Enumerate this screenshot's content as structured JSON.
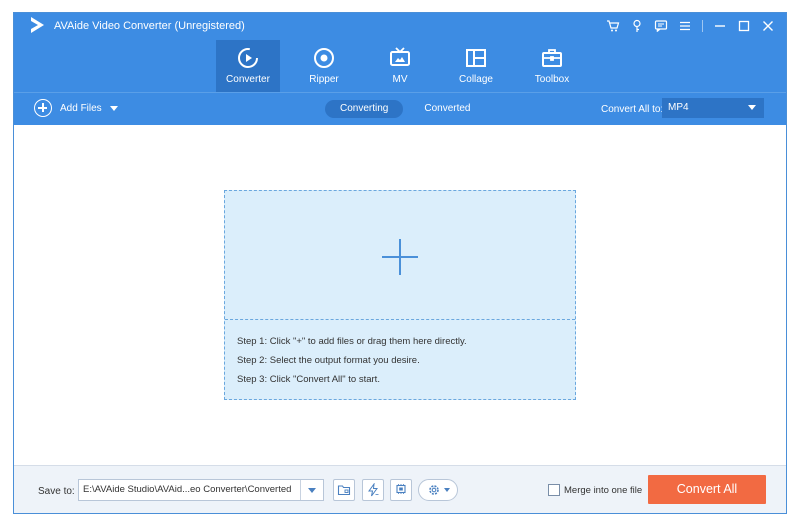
{
  "app": {
    "title": "AVAide Video Converter (Unregistered)"
  },
  "window_controls": [
    {
      "name": "cart-icon"
    },
    {
      "name": "key-icon"
    },
    {
      "name": "feedback-icon"
    },
    {
      "name": "menu-icon"
    },
    {
      "name": "minimize-icon"
    },
    {
      "name": "maximize-icon"
    },
    {
      "name": "close-icon"
    }
  ],
  "tabs": [
    {
      "label": "Converter",
      "icon": "converter-icon",
      "active": true
    },
    {
      "label": "Ripper",
      "icon": "ripper-icon",
      "active": false
    },
    {
      "label": "MV",
      "icon": "mv-icon",
      "active": false
    },
    {
      "label": "Collage",
      "icon": "collage-icon",
      "active": false
    },
    {
      "label": "Toolbox",
      "icon": "toolbox-icon",
      "active": false
    }
  ],
  "toolbar": {
    "add_files_label": "Add Files",
    "segments": [
      {
        "label": "Converting",
        "active": true
      },
      {
        "label": "Converted",
        "active": false
      }
    ],
    "convert_all_to_label": "Convert All to:",
    "format_value": "MP4"
  },
  "dropzone": {
    "steps": [
      "Step 1: Click \"+\" to add files or drag them here directly.",
      "Step 2: Select the output format you desire.",
      "Step 3: Click \"Convert All\" to start."
    ]
  },
  "bottom": {
    "save_to_label": "Save to:",
    "path_value": "E:\\AVAide Studio\\AVAid...eo Converter\\Converted",
    "merge_label": "Merge into one file",
    "merge_checked": false,
    "convert_all_label": "Convert All"
  },
  "colors": {
    "accent": "#3d8ce3",
    "active_tab": "#2d74c6",
    "convert_button": "#f26a42",
    "dropzone_bg": "#dbeefb"
  }
}
